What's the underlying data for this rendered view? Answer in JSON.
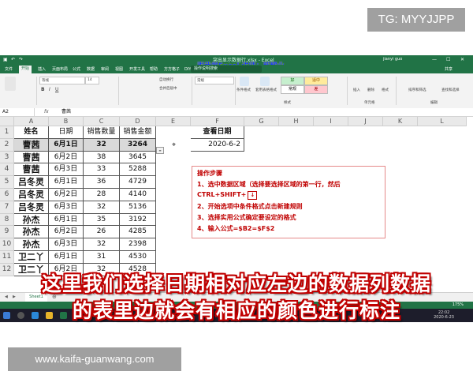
{
  "watermark_top": "TG: MYYJJPP",
  "watermark_bottom": "www.kaifa-guanwang.com",
  "window": {
    "title": "突出显示数据行.xlsx - Excel",
    "overlay_title": "跟我学Excel  讲师：郭耀业",
    "user": "jianyi guo",
    "search_placeholder": "操作说明搜索"
  },
  "menu": [
    "文件",
    "开始",
    "插入",
    "页面布局",
    "公式",
    "数据",
    "审阅",
    "视图",
    "开发工具",
    "帮助",
    "方方格子",
    "DIY工具箱"
  ],
  "menu_active": "开始",
  "share_label": "共享",
  "ribbon": {
    "font_name": "等线",
    "font_size": "14",
    "wrap_label": "自动换行",
    "merge_label": "合并后居中",
    "number_format": "常规",
    "cond_format": "条件格式",
    "table_format": "套用表格格式",
    "style_good": "好",
    "style_neutral": "适中",
    "style_normal": "常规",
    "style_bad": "差",
    "insert": "插入",
    "delete": "删除",
    "format": "格式",
    "sort_filter": "排序和筛选",
    "find_select": "查找和选择",
    "group_styles": "样式",
    "group_cells": "单元格",
    "group_edit": "编辑"
  },
  "formula_bar": {
    "name_box": "A2",
    "fx": "fx",
    "value": "曹茜"
  },
  "columns": [
    "A",
    "B",
    "C",
    "D",
    "E",
    "F",
    "G",
    "H",
    "I",
    "J",
    "K",
    "L"
  ],
  "rows": [
    "1",
    "2",
    "3",
    "4",
    "5",
    "6",
    "7",
    "8",
    "9",
    "10",
    "11",
    "12"
  ],
  "table": {
    "headers": [
      "姓名",
      "日期",
      "销售数量",
      "销售金额"
    ],
    "rows": [
      [
        "曹茜",
        "6月1日",
        "32",
        "3264"
      ],
      [
        "曹茜",
        "6月2日",
        "38",
        "3645"
      ],
      [
        "曹茜",
        "6月3日",
        "33",
        "5288"
      ],
      [
        "吕冬灵",
        "6月1日",
        "36",
        "4729"
      ],
      [
        "吕冬灵",
        "6月2日",
        "28",
        "4140"
      ],
      [
        "吕冬灵",
        "6月3日",
        "32",
        "5136"
      ],
      [
        "孙杰",
        "6月1日",
        "35",
        "3192"
      ],
      [
        "孙杰",
        "6月2日",
        "26",
        "4285"
      ],
      [
        "孙杰",
        "6月3日",
        "32",
        "2398"
      ],
      [
        "卫二丫",
        "6月1日",
        "31",
        "4530"
      ],
      [
        "卫二丫",
        "6月2日",
        "32",
        "4528"
      ]
    ]
  },
  "lookup": {
    "label": "查看日期",
    "value": "2020-6-2"
  },
  "steps": {
    "title": "操作步骤",
    "line1": "1、选中数据区域（选择要选择区域的第一行，然后",
    "line2_prefix": "CTRL+SHIFT+",
    "line2_key": "↓",
    "line3": "2、开始选项中条件格式点击新建规则",
    "line4": "3、选择实用公式确定要设定的格式",
    "line5": "4、输入公式=$B2=$F$2"
  },
  "sheet_tab": "Sheet1",
  "zoom": "175%",
  "clock": {
    "time": "22:02",
    "date": "2020-6-23"
  },
  "subtitle": {
    "line1": "这里我们选择日期相对应左边的数据列数据",
    "line2": "的表里边就会有相应的颜色进行标注"
  },
  "colors": {
    "excel_green": "#217346",
    "steps_red": "#c00000",
    "overlay_blue": "#1a3cff"
  }
}
